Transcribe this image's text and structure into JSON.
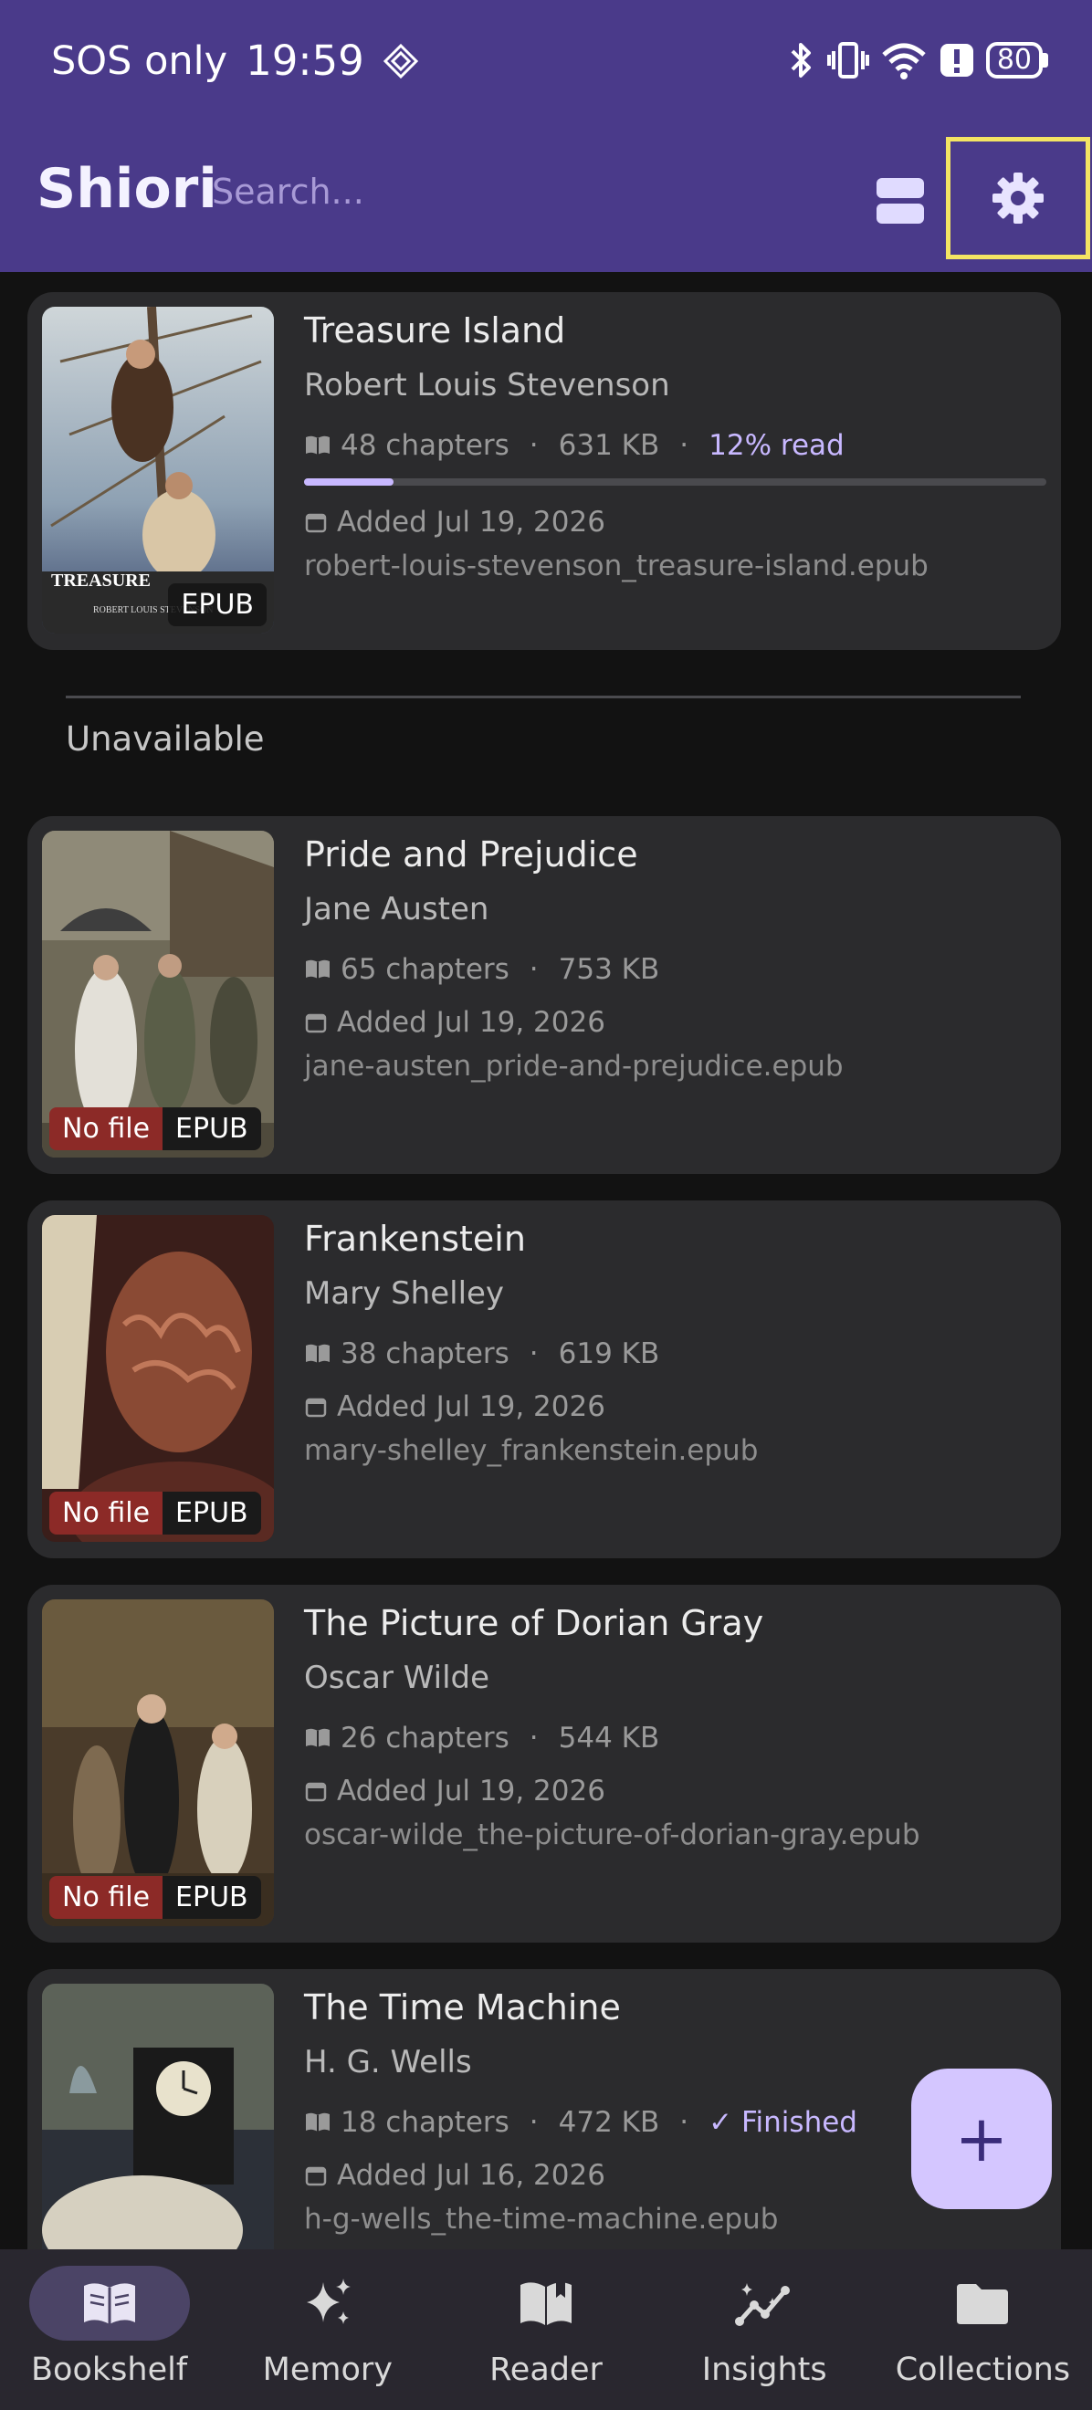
{
  "status_bar": {
    "carrier": "SOS only",
    "time": "19:59",
    "battery": "80"
  },
  "app_bar": {
    "title": "Shiori",
    "search_placeholder": "Search..."
  },
  "colors": {
    "app_bar": "#4a3a8a",
    "accent": "#c8b8ff",
    "no_file_badge": "#8c2a27",
    "card": "#2b2b2d",
    "fab": "#d4c6ff",
    "highlight_border": "#f4e463"
  },
  "books": [
    {
      "title": "Treasure Island",
      "author": "Robert Louis Stevenson",
      "chapters": "48 chapters",
      "size": "631 KB",
      "status": "12% read",
      "progress": 0.12,
      "added": "Added Jul 19, 2026",
      "filename": "robert-louis-stevenson_treasure-island.epub",
      "format": "EPUB",
      "cover_text": "TREASURE",
      "cover_subtext": "ROBERT LOUIS STEVENSON"
    }
  ],
  "unavailable_section": {
    "label": "Unavailable",
    "books": [
      {
        "title": "Pride and Prejudice",
        "author": "Jane Austen",
        "chapters": "65 chapters",
        "size": "753 KB",
        "added": "Added Jul 19, 2026",
        "filename": "jane-austen_pride-and-prejudice.epub",
        "no_file": "No file",
        "format": "EPUB"
      },
      {
        "title": "Frankenstein",
        "author": "Mary Shelley",
        "chapters": "38 chapters",
        "size": "619 KB",
        "added": "Added Jul 19, 2026",
        "filename": "mary-shelley_frankenstein.epub",
        "no_file": "No file",
        "format": "EPUB"
      },
      {
        "title": "The Picture of Dorian Gray",
        "author": "Oscar Wilde",
        "chapters": "26 chapters",
        "size": "544 KB",
        "added": "Added Jul 19, 2026",
        "filename": "oscar-wilde_the-picture-of-dorian-gray.epub",
        "no_file": "No file",
        "format": "EPUB"
      },
      {
        "title": "The Time Machine",
        "author": "H. G. Wells",
        "chapters": "18 chapters",
        "size": "472 KB",
        "status": "✓ Finished",
        "added": "Added Jul 16, 2026",
        "filename": "h-g-wells_the-time-machine.epub"
      }
    ]
  },
  "fab": {
    "label": "+"
  },
  "bottom_nav": [
    {
      "label": "Bookshelf",
      "icon": "book-open-icon",
      "active": true
    },
    {
      "label": "Memory",
      "icon": "sparkles-icon",
      "active": false
    },
    {
      "label": "Reader",
      "icon": "reader-book-icon",
      "active": false
    },
    {
      "label": "Insights",
      "icon": "insights-icon",
      "active": false
    },
    {
      "label": "Collections",
      "icon": "folder-icon",
      "active": false
    }
  ]
}
